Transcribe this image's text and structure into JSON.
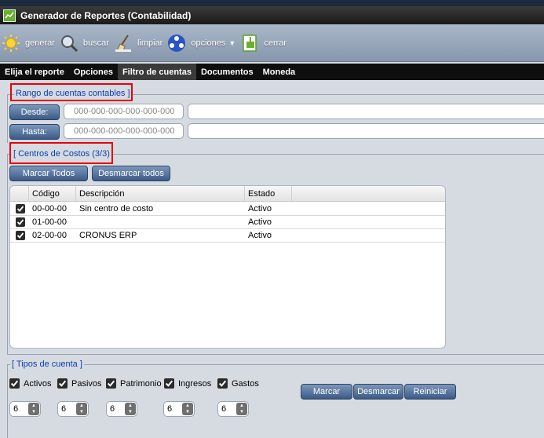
{
  "window": {
    "title": "Generador de Reportes (Contabilidad)"
  },
  "toolbar": {
    "generar": "generar",
    "buscar": "buscar",
    "limpiar": "limpiar",
    "opciones": "opciones",
    "cerrar": "cerrar"
  },
  "menu": {
    "items": [
      "Elija el reporte",
      "Opciones",
      "Filtro de cuentas",
      "Documentos",
      "Moneda"
    ],
    "active": "Filtro de cuentas"
  },
  "rango": {
    "legend": "Rango de cuentas contables ]",
    "desde_label": "Desde:",
    "hasta_label": "Hasta:",
    "desde_placeholder": "000-000-000-000-000-000",
    "hasta_placeholder": "000-000-000-000-000-000"
  },
  "centros": {
    "legend": "[ Centros de Costos (3/3)",
    "marcar_todos": "Marcar Todos",
    "desmarcar_todos": "Desmarcar todos",
    "columns": [
      "Código",
      "Descripción",
      "Estado"
    ],
    "rows": [
      {
        "codigo": "00-00-00",
        "descripcion": "Sin centro de costo",
        "estado": "Activo",
        "checked": true
      },
      {
        "codigo": "01-00-00",
        "descripcion": "",
        "estado": "Activo",
        "checked": true
      },
      {
        "codigo": "02-00-00",
        "descripcion": "CRONUS ERP",
        "estado": "Activo",
        "checked": true
      }
    ]
  },
  "tipos": {
    "legend": "[ Tipos de cuenta ]",
    "items": [
      {
        "label": "Activos",
        "checked": true,
        "level": "6"
      },
      {
        "label": "Pasivos",
        "checked": true,
        "level": "6"
      },
      {
        "label": "Patrimonio",
        "checked": true,
        "level": "6"
      },
      {
        "label": "Ingresos",
        "checked": true,
        "level": "6"
      },
      {
        "label": "Gastos",
        "checked": true,
        "level": "6"
      }
    ],
    "marcar": "Marcar",
    "desmarcar": "Desmarcar",
    "reiniciar": "Reiniciar"
  },
  "colors": {
    "accent": "#0a3fae",
    "button": "#3a5a87",
    "highlight": "#e8000b"
  }
}
